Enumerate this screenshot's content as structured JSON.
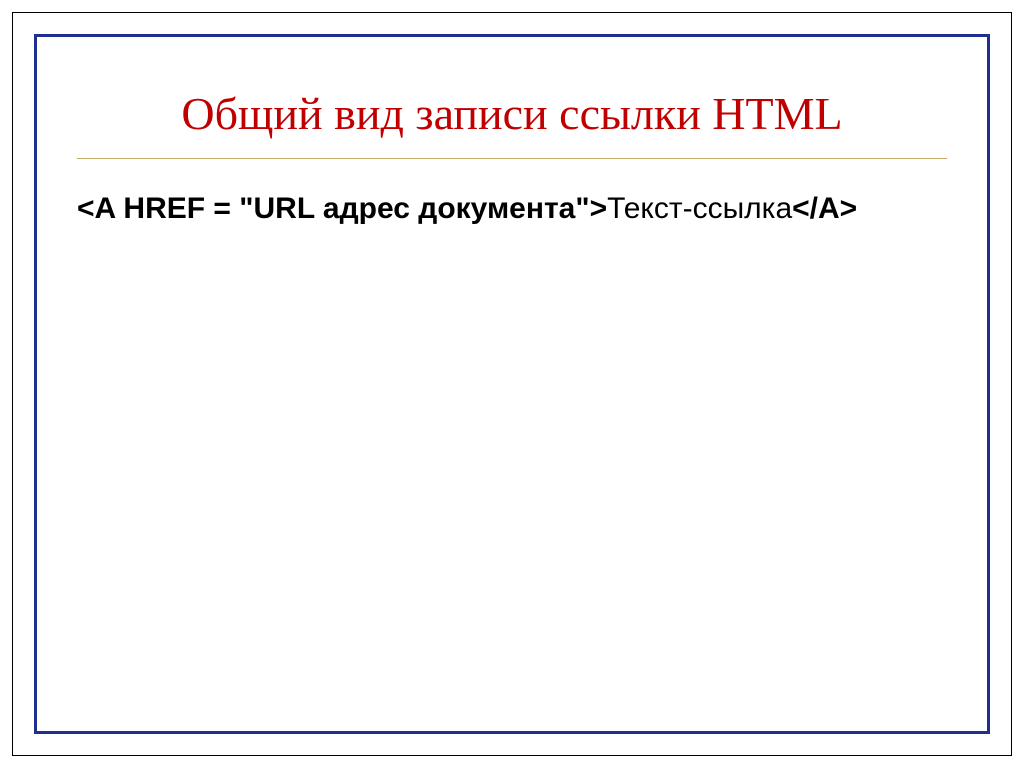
{
  "slide": {
    "title": "Общий вид записи ссылки HTML",
    "code_bold": "<A HREF = \"URL адрес документа\">",
    "code_plain": "Текст-ссылка",
    "code_bold_close": "</A>"
  }
}
